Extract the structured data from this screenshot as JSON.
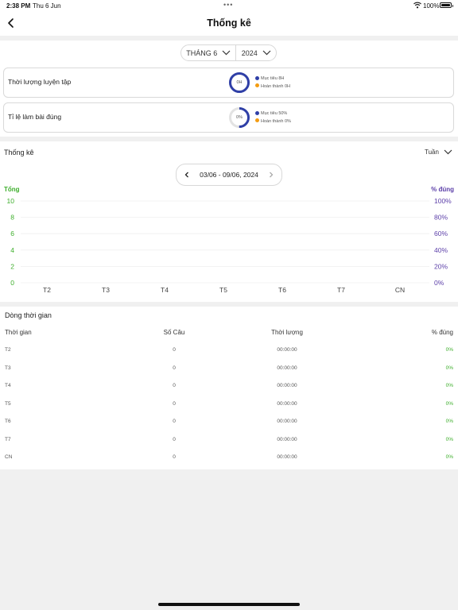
{
  "status_bar": {
    "time": "2:38 PM",
    "date": "Thu 6 Jun",
    "dots": "•••",
    "battery": "100%"
  },
  "header": {
    "title": "Thống kê"
  },
  "picker": {
    "month": "THÁNG 6",
    "year": "2024"
  },
  "stats": [
    {
      "label": "Thời lượng luyện tập",
      "center": "0H",
      "target": "Mục tiêu 8H",
      "done": "Hoàn thành 0H",
      "progress": 1.0
    },
    {
      "label": "Tỉ lệ làm bài đúng",
      "center": "0%",
      "target": "Mục tiêu 50%",
      "done": "Hoàn thành 0%",
      "progress": 0.5
    }
  ],
  "chart_section": {
    "title": "Thống kê",
    "period": "Tuần",
    "range": "03/06 - 09/06, 2024"
  },
  "colors": {
    "accent": "#2f3fa7",
    "green": "#3dae2b",
    "purple": "#5b3ea8",
    "orange": "#f39c12",
    "ring_bg": "#e3e3e3"
  },
  "chart_data": {
    "type": "bar",
    "ylabel_left": "Tổng",
    "ylabel_right": "% đúng",
    "categories": [
      "T2",
      "T3",
      "T4",
      "T5",
      "T6",
      "T7",
      "CN"
    ],
    "left_ticks": [
      "10",
      "8",
      "6",
      "4",
      "2",
      "0"
    ],
    "right_ticks": [
      "100%",
      "80%",
      "60%",
      "40%",
      "20%",
      "0%"
    ],
    "ylim_left": [
      0,
      10
    ],
    "ylim_right": [
      0,
      100
    ],
    "series": [
      {
        "values": [
          0,
          0,
          0,
          0,
          0,
          0,
          0
        ]
      }
    ],
    "grid": true
  },
  "table": {
    "title": "Dòng thời gian",
    "headers": [
      "Thời gian",
      "Số Câu",
      "Thời lượng",
      "% đúng"
    ],
    "rows": [
      [
        "T2",
        "0",
        "00:00:00",
        "0%"
      ],
      [
        "T3",
        "0",
        "00:00:00",
        "0%"
      ],
      [
        "T4",
        "0",
        "00:00:00",
        "0%"
      ],
      [
        "T5",
        "0",
        "00:00:00",
        "0%"
      ],
      [
        "T6",
        "0",
        "00:00:00",
        "0%"
      ],
      [
        "T7",
        "0",
        "00:00:00",
        "0%"
      ],
      [
        "CN",
        "0",
        "00:00:00",
        "0%"
      ]
    ]
  }
}
